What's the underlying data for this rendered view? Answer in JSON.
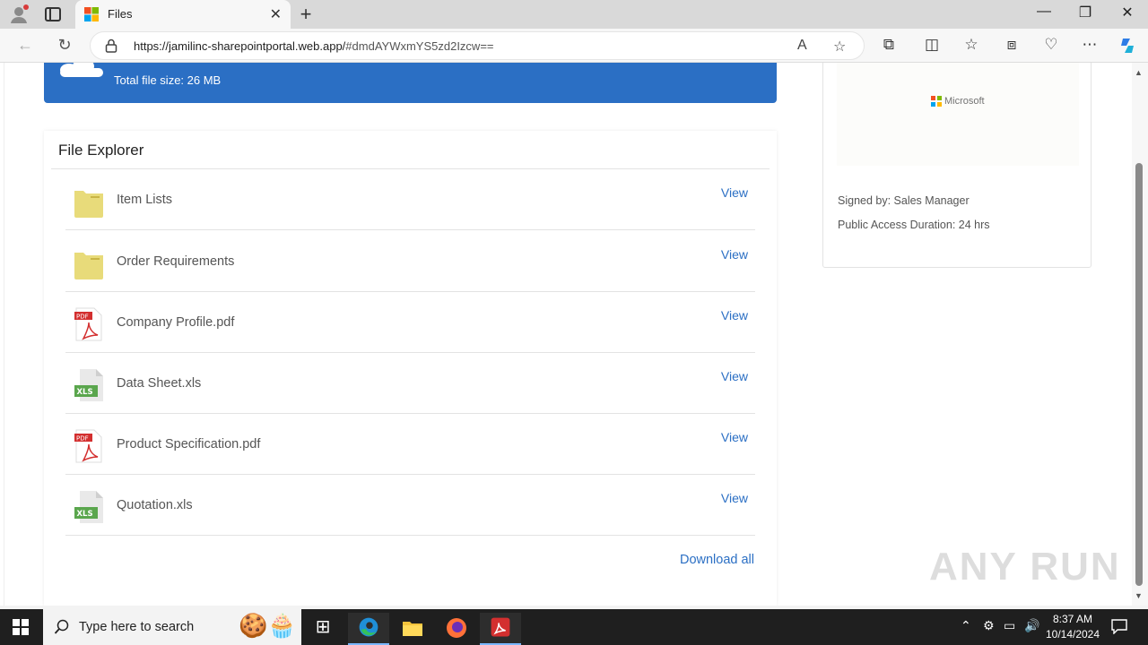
{
  "browser": {
    "tab_title": "Files",
    "tab_close": "✕",
    "new_tab": "+",
    "url_host": "https://jamilinc-sharepointportal.web.app/",
    "url_rest": "#dmdAYWxmYS5zd2Izcw==",
    "window_controls": {
      "minimize": "—",
      "restore": "❐",
      "close": "✕"
    }
  },
  "banner": {
    "total_size": "Total file size: 26 MB"
  },
  "explorer": {
    "title": "File Explorer",
    "files": [
      {
        "name": "Item Lists",
        "type": "folder",
        "action": "View"
      },
      {
        "name": "Order Requirements",
        "type": "folder",
        "action": "View"
      },
      {
        "name": "Company Profile.pdf",
        "type": "pdf",
        "action": "View"
      },
      {
        "name": "Data Sheet.xls",
        "type": "xls",
        "action": "View"
      },
      {
        "name": "Product Specification.pdf",
        "type": "pdf",
        "action": "View"
      },
      {
        "name": "Quotation.xls",
        "type": "xls",
        "action": "View"
      }
    ],
    "download_all": "Download all"
  },
  "sign_card": {
    "logo_text": "Microsoft",
    "signed_by": "Signed by: Sales Manager",
    "access_duration": "Public Access Duration: 24 hrs"
  },
  "watermark": "ANY RUN",
  "taskbar": {
    "search_placeholder": "Type here to search",
    "time": "8:37 AM",
    "date": "10/14/2024"
  },
  "colors": {
    "accent": "#2b6fc4",
    "folder": "#e8db7a",
    "pdf_red": "#d32f2f",
    "xls_green": "#5aa64d"
  }
}
